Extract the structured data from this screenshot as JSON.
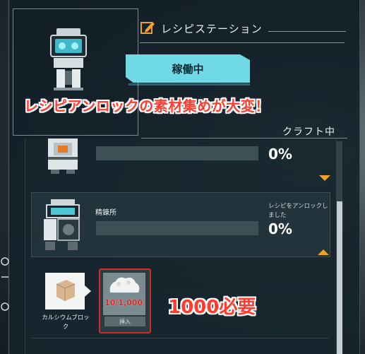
{
  "header": {
    "title": "レシピステーション",
    "status_label": "稼働中"
  },
  "banner": {
    "text": "レシピアンロックの素材集めが大変！"
  },
  "crafting": {
    "section_label": "クラフト中",
    "items": [
      {
        "name": "",
        "progress_percent": 0,
        "percent_label": "0%",
        "expanded": false
      },
      {
        "name": "精錬所",
        "progress_percent": 0,
        "percent_label": "0%",
        "note": "レシピをアンロックしました",
        "expanded": true
      }
    ]
  },
  "material": {
    "name": "カルシウムブロック",
    "count_label": "10/1,000",
    "insert_button": "挿入"
  },
  "annotation": {
    "text": "1000必要"
  },
  "colors": {
    "accent_cyan": "#6fd9e6",
    "highlight_red": "#d42b22",
    "banner_red": "#ff3c30",
    "arrow_orange": "#f0a127"
  }
}
